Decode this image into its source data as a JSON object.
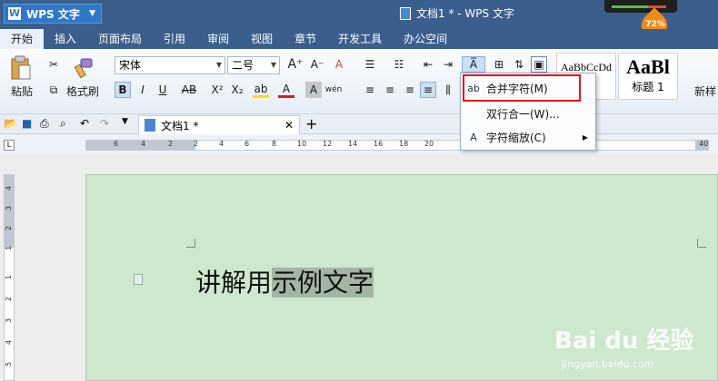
{
  "app": {
    "name": "WPS 文字",
    "doc_title": "文档1 * - WPS 文字",
    "battery": "72%"
  },
  "menu": [
    "开始",
    "插入",
    "页面布局",
    "引用",
    "审阅",
    "视图",
    "章节",
    "开发工具",
    "办公空间"
  ],
  "ribbon": {
    "paste": "粘贴",
    "format_painter": "格式刷",
    "font_name": "宋体",
    "font_size": "二号",
    "style1_preview": "AaBbCcDd",
    "style2_preview": "AaBl",
    "style2_label": "标题 1",
    "new_style": "新样"
  },
  "doc_tab": {
    "title": "文档1 *"
  },
  "ruler": {
    "h_ticks": [
      "6",
      "4",
      "2",
      "2",
      "4",
      "6",
      "8",
      "10",
      "12",
      "14",
      "16",
      "18",
      "20",
      "40"
    ],
    "v_ticks": [
      "4",
      "3",
      "2",
      "1",
      "1",
      "2",
      "3",
      "4",
      "5"
    ]
  },
  "document": {
    "text_plain": "讲解用",
    "text_highlight": "示例文字"
  },
  "menu_popup": {
    "items": [
      {
        "icon": "merge-chars-icon",
        "label": "合并字符(M)",
        "glyph": "ab"
      },
      {
        "icon": "two-lines-in-one-icon",
        "label": "双行合一(W)...",
        "glyph": ""
      },
      {
        "icon": "char-scale-icon",
        "label": "字符缩放(C)",
        "glyph": "A"
      }
    ]
  },
  "watermark": {
    "brand": "Bai du 经验",
    "url": "jingyan.baidu.com"
  }
}
